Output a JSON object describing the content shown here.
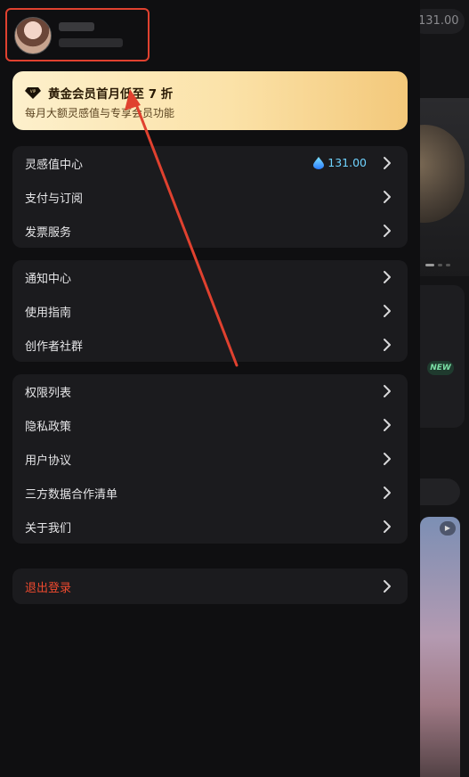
{
  "background": {
    "balance": "131.00",
    "new_badge": "NEW"
  },
  "vip": {
    "title": "黄金会员首月低至 7 折",
    "subtitle": "每月大额灵感值与专享会员功能"
  },
  "groups": [
    {
      "items": [
        {
          "label": "灵感值中心",
          "value": "131.00"
        },
        {
          "label": "支付与订阅"
        },
        {
          "label": "发票服务"
        }
      ]
    },
    {
      "items": [
        {
          "label": "通知中心"
        },
        {
          "label": "使用指南"
        },
        {
          "label": "创作者社群"
        }
      ]
    },
    {
      "items": [
        {
          "label": "权限列表"
        },
        {
          "label": "隐私政策"
        },
        {
          "label": "用户协议"
        },
        {
          "label": "三方数据合作清单"
        },
        {
          "label": "关于我们"
        }
      ]
    }
  ],
  "logout": {
    "label": "退出登录"
  },
  "colors": {
    "accent_red": "#e0412f",
    "logout_text": "#f04a2e",
    "balance_blue": "#6fd3ff",
    "vip_gold": "#fbe2a8"
  },
  "icons": [
    "vip-diamond-icon",
    "inspiration-drop-icon",
    "chevron-right-icon",
    "play-icon"
  ]
}
